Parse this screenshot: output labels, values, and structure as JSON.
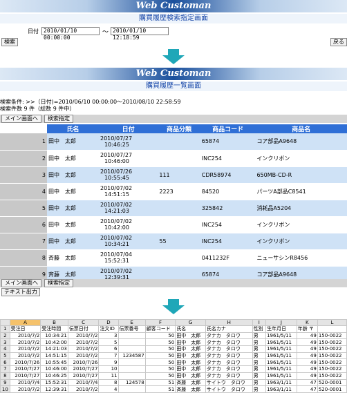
{
  "banner": {
    "title": "Web Customan"
  },
  "screen1": {
    "subtitle": "購買履歴検索指定画面",
    "date_label": "日付",
    "date_from": "2010/01/10 00:00:00",
    "tilde": "〜",
    "date_to": "2010/01/10 12:18:59",
    "search_button": "検索",
    "back_button": "戻る"
  },
  "screen2": {
    "subtitle": "購買履歴一覧画面",
    "condition": "検索条件: >>（日付)=2010/06/10 00:00:00〜2010/08/10 22:58:59",
    "count": "検索件数 9 件（総数 9 件中）",
    "nav_menu": "メイン画面へ",
    "nav_search": "検索指定",
    "text_output": "テキスト出力",
    "columns": [
      "氏名",
      "日付",
      "商品分類",
      "商品コード",
      "商品名"
    ],
    "rows": [
      {
        "no": "1",
        "name": "田中　太郎",
        "date": "2010/07/27",
        "time": "10:46:25",
        "cat": "",
        "code": "65874",
        "item": "コア部品A9648"
      },
      {
        "no": "2",
        "name": "田中　太郎",
        "date": "2010/07/27",
        "time": "10:46:00",
        "cat": "",
        "code": "INC254",
        "item": "インクリボン"
      },
      {
        "no": "3",
        "name": "田中　太郎",
        "date": "2010/07/26",
        "time": "10:55:45",
        "cat": "111",
        "code": "CDR58974",
        "item": "650MB-CD-R"
      },
      {
        "no": "4",
        "name": "田中　太郎",
        "date": "2010/07/02",
        "time": "14:51:15",
        "cat": "2223",
        "code": "84520",
        "item": "パーツA部品C8541"
      },
      {
        "no": "5",
        "name": "田中　太郎",
        "date": "2010/07/02",
        "time": "14:21:03",
        "cat": "",
        "code": "325842",
        "item": "消耗品A5204"
      },
      {
        "no": "6",
        "name": "田中　太郎",
        "date": "2010/07/02",
        "time": "10:42:00",
        "cat": "",
        "code": "INC254",
        "item": "インクリボン"
      },
      {
        "no": "7",
        "name": "田中　太郎",
        "date": "2010/07/02",
        "time": "10:34:21",
        "cat": "55",
        "code": "INC254",
        "item": "インクリボン"
      },
      {
        "no": "8",
        "name": "斉藤　太郎",
        "date": "2010/07/04",
        "time": "15:52:31",
        "cat": "",
        "code": "0411232F",
        "item": "ニューサシンR8456"
      },
      {
        "no": "9",
        "name": "斉藤　太郎",
        "date": "2010/07/02",
        "time": "12:39:31",
        "cat": "",
        "code": "65874",
        "item": "コア部品A9648"
      }
    ]
  },
  "sheet": {
    "col_letters": [
      "",
      "A",
      "B",
      "C",
      "D",
      "E",
      "F",
      "G",
      "H",
      "I",
      "J",
      "K",
      "L"
    ],
    "rows": [
      [
        "1",
        "受注日",
        "受注時間",
        "伝票日付",
        "注文ID",
        "伝票番号",
        "顧客コード",
        "氏名",
        "氏名カナ",
        "性別",
        "生年月日",
        "年齢 〒",
        ""
      ],
      [
        "2",
        "2010/7/2",
        "10:34:21",
        "2010/7/2",
        "3",
        "",
        "50",
        "田中　太郎",
        "タナカ　タロウ",
        "男",
        "1961/5/11",
        "49",
        "150-0022"
      ],
      [
        "3",
        "2010/7/2",
        "10:42:00",
        "2010/7/2",
        "5",
        "",
        "50",
        "田中　太郎",
        "タナカ　タロウ",
        "男",
        "1961/5/11",
        "49",
        "150-0022"
      ],
      [
        "4",
        "2010/7/2",
        "14:21:03",
        "2010/7/2",
        "6",
        "",
        "50",
        "田中　太郎",
        "タナカ　タロウ",
        "男",
        "1961/5/11",
        "49",
        "150-0022"
      ],
      [
        "5",
        "2010/7/2",
        "14:51:15",
        "2010/7/2",
        "7",
        "1234587",
        "50",
        "田中　太郎",
        "タナカ　タロウ",
        "男",
        "1961/5/11",
        "49",
        "150-0022"
      ],
      [
        "6",
        "2010/7/26",
        "10:55:45",
        "2010/7/26",
        "9",
        "",
        "50",
        "田中　太郎",
        "タナカ　タロウ",
        "男",
        "1961/5/11",
        "49",
        "150-0022"
      ],
      [
        "7",
        "2010/7/27",
        "10:46:00",
        "2010/7/27",
        "10",
        "",
        "50",
        "田中　太郎",
        "タナカ　タロウ",
        "男",
        "1961/5/11",
        "49",
        "150-0022"
      ],
      [
        "8",
        "2010/7/27",
        "10:46:25",
        "2010/7/27",
        "11",
        "",
        "50",
        "田中　太郎",
        "タナカ　タロウ",
        "男",
        "1961/5/11",
        "49",
        "150-0022"
      ],
      [
        "9",
        "2010/7/4",
        "15:52:31",
        "2010/7/4",
        "8",
        "124578",
        "51",
        "斉藤　太郎",
        "サイトウ　タロウ",
        "男",
        "1963/1/11",
        "47",
        "520-0001"
      ],
      [
        "10",
        "2010/7/2",
        "12:39:31",
        "2010/7/2",
        "4",
        "",
        "51",
        "斉藤　太郎",
        "サイトウ　タロウ",
        "男",
        "1963/1/11",
        "47",
        "520-0001"
      ]
    ]
  }
}
